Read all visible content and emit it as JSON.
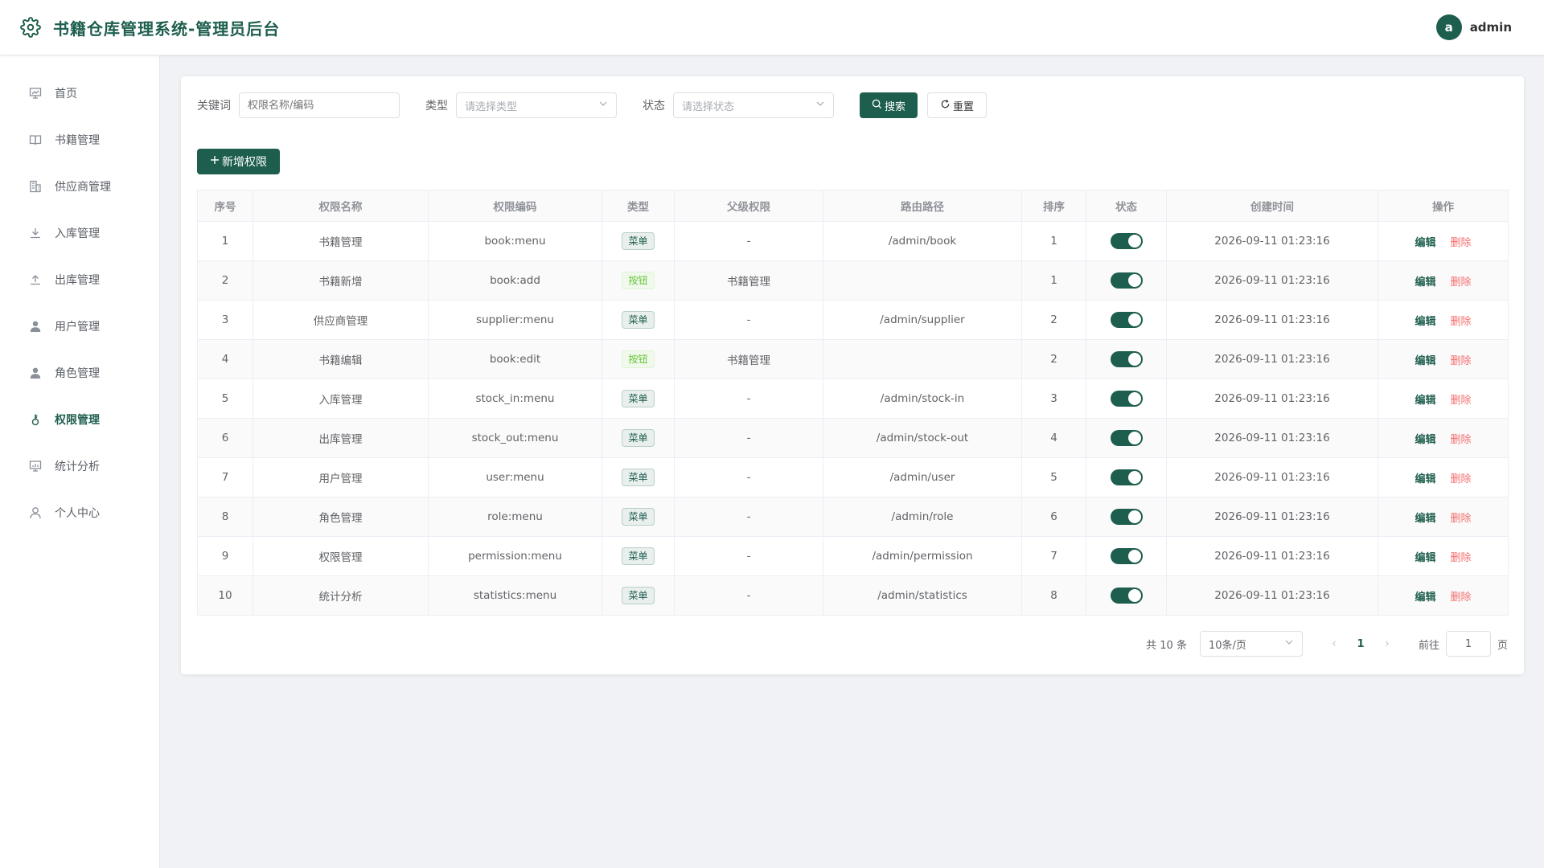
{
  "header": {
    "title": "书籍仓库管理系统-管理员后台",
    "avatar_letter": "a",
    "username": "admin"
  },
  "sidebar": {
    "items": [
      {
        "label": "首页",
        "icon": "dashboard-icon"
      },
      {
        "label": "书籍管理",
        "icon": "book-icon"
      },
      {
        "label": "供应商管理",
        "icon": "building-icon"
      },
      {
        "label": "入库管理",
        "icon": "download-icon"
      },
      {
        "label": "出库管理",
        "icon": "upload-icon"
      },
      {
        "label": "用户管理",
        "icon": "user-filled-icon"
      },
      {
        "label": "角色管理",
        "icon": "user-filled-icon"
      },
      {
        "label": "权限管理",
        "icon": "key-icon",
        "active": true
      },
      {
        "label": "统计分析",
        "icon": "chart-icon"
      },
      {
        "label": "个人中心",
        "icon": "user-icon"
      }
    ]
  },
  "filter": {
    "keyword_label": "关键词",
    "keyword_placeholder": "权限名称/编码",
    "type_label": "类型",
    "type_placeholder": "请选择类型",
    "status_label": "状态",
    "status_placeholder": "请选择状态",
    "search_label": "搜索",
    "reset_label": "重置"
  },
  "add_button_label": "新增权限",
  "table": {
    "columns": [
      "序号",
      "权限名称",
      "权限编码",
      "类型",
      "父级权限",
      "路由路径",
      "排序",
      "状态",
      "创建时间",
      "操作"
    ],
    "edit_label": "编辑",
    "delete_label": "删除",
    "rows": [
      {
        "no": "1",
        "name": "书籍管理",
        "code": "book:menu",
        "type": "菜单",
        "type_kind": "menu",
        "parent": "-",
        "path": "/admin/book",
        "sort": "1",
        "enabled": true,
        "created": "2026-09-11 01:23:16"
      },
      {
        "no": "2",
        "name": "书籍新增",
        "code": "book:add",
        "type": "按钮",
        "type_kind": "button",
        "parent": "书籍管理",
        "path": "",
        "sort": "1",
        "enabled": true,
        "created": "2026-09-11 01:23:16"
      },
      {
        "no": "3",
        "name": "供应商管理",
        "code": "supplier:menu",
        "type": "菜单",
        "type_kind": "menu",
        "parent": "-",
        "path": "/admin/supplier",
        "sort": "2",
        "enabled": true,
        "created": "2026-09-11 01:23:16"
      },
      {
        "no": "4",
        "name": "书籍编辑",
        "code": "book:edit",
        "type": "按钮",
        "type_kind": "button",
        "parent": "书籍管理",
        "path": "",
        "sort": "2",
        "enabled": true,
        "created": "2026-09-11 01:23:16"
      },
      {
        "no": "5",
        "name": "入库管理",
        "code": "stock_in:menu",
        "type": "菜单",
        "type_kind": "menu",
        "parent": "-",
        "path": "/admin/stock-in",
        "sort": "3",
        "enabled": true,
        "created": "2026-09-11 01:23:16"
      },
      {
        "no": "6",
        "name": "出库管理",
        "code": "stock_out:menu",
        "type": "菜单",
        "type_kind": "menu",
        "parent": "-",
        "path": "/admin/stock-out",
        "sort": "4",
        "enabled": true,
        "created": "2026-09-11 01:23:16"
      },
      {
        "no": "7",
        "name": "用户管理",
        "code": "user:menu",
        "type": "菜单",
        "type_kind": "menu",
        "parent": "-",
        "path": "/admin/user",
        "sort": "5",
        "enabled": true,
        "created": "2026-09-11 01:23:16"
      },
      {
        "no": "8",
        "name": "角色管理",
        "code": "role:menu",
        "type": "菜单",
        "type_kind": "menu",
        "parent": "-",
        "path": "/admin/role",
        "sort": "6",
        "enabled": true,
        "created": "2026-09-11 01:23:16"
      },
      {
        "no": "9",
        "name": "权限管理",
        "code": "permission:menu",
        "type": "菜单",
        "type_kind": "menu",
        "parent": "-",
        "path": "/admin/permission",
        "sort": "7",
        "enabled": true,
        "created": "2026-09-11 01:23:16"
      },
      {
        "no": "10",
        "name": "统计分析",
        "code": "statistics:menu",
        "type": "菜单",
        "type_kind": "menu",
        "parent": "-",
        "path": "/admin/statistics",
        "sort": "8",
        "enabled": true,
        "created": "2026-09-11 01:23:16"
      }
    ]
  },
  "pagination": {
    "total_text": "共 10 条",
    "page_size": "10条/页",
    "current_page": "1",
    "goto_label": "前往",
    "goto_value": "1",
    "page_suffix": "页"
  },
  "colors": {
    "primary": "#1e5e4e",
    "danger": "#f56c6c",
    "button_tag": "#67c23a"
  }
}
